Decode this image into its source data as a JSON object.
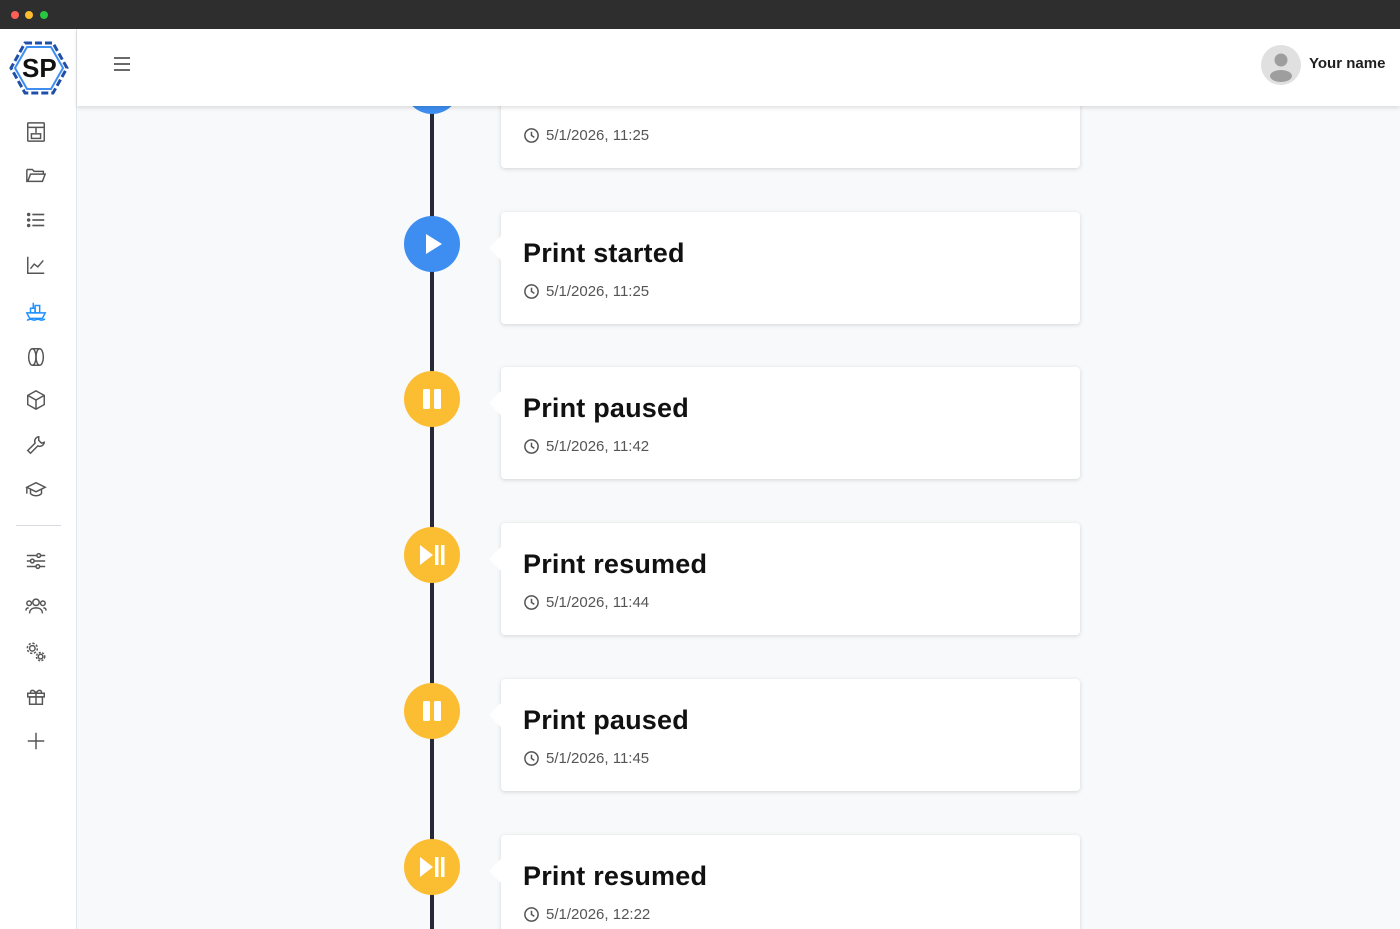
{
  "app": {
    "logo_text": "SP",
    "brand_color": "#1f4fa8",
    "accent_color": "#3d8ef0",
    "warning_color": "#fbbd32"
  },
  "header": {
    "menu_icon": "hamburger-icon",
    "user_name": "Your name",
    "avatar_icon": "user-avatar-icon"
  },
  "sidebar": {
    "items": [
      {
        "name": "printer",
        "icon": "printer-icon"
      },
      {
        "name": "files",
        "icon": "folder-open-icon"
      },
      {
        "name": "queue",
        "icon": "list-icon"
      },
      {
        "name": "stats",
        "icon": "chart-line-icon"
      },
      {
        "name": "fleet",
        "icon": "ship-icon",
        "active": true
      },
      {
        "name": "filament",
        "icon": "spool-icon"
      },
      {
        "name": "models",
        "icon": "cube-icon"
      },
      {
        "name": "maintenance",
        "icon": "wrench-icon"
      },
      {
        "name": "learn",
        "icon": "graduation-cap-icon"
      },
      {
        "name": "preferences",
        "icon": "sliders-icon"
      },
      {
        "name": "users",
        "icon": "users-icon"
      },
      {
        "name": "settings",
        "icon": "gears-icon"
      },
      {
        "name": "gifts",
        "icon": "gift-icon"
      },
      {
        "name": "add",
        "icon": "plus-icon"
      }
    ]
  },
  "timeline": {
    "events": [
      {
        "title": "",
        "time": "5/1/2026, 11:25",
        "type": "started",
        "icon": "play-icon"
      },
      {
        "title": "Print started",
        "time": "5/1/2026, 11:25",
        "type": "started",
        "icon": "play-icon"
      },
      {
        "title": "Print paused",
        "time": "5/1/2026, 11:42",
        "type": "paused",
        "icon": "pause-icon"
      },
      {
        "title": "Print resumed",
        "time": "5/1/2026, 11:44",
        "type": "resumed",
        "icon": "play-pause-icon"
      },
      {
        "title": "Print paused",
        "time": "5/1/2026, 11:45",
        "type": "paused",
        "icon": "pause-icon"
      },
      {
        "title": "Print resumed",
        "time": "5/1/2026, 12:22",
        "type": "resumed",
        "icon": "play-pause-icon"
      }
    ]
  }
}
